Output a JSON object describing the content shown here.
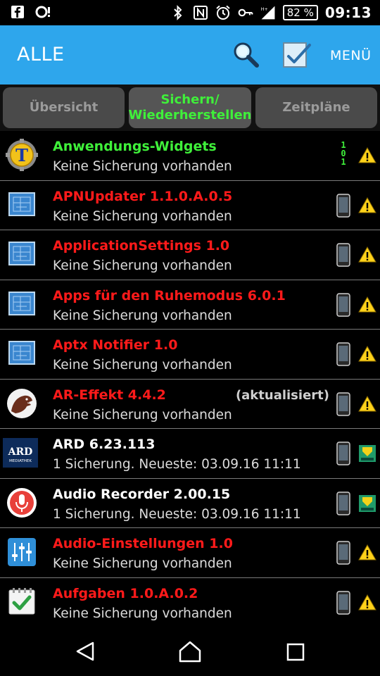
{
  "status_bar": {
    "time": "09:13",
    "battery": "82 %",
    "icons": [
      "facebook-icon",
      "notification-icon",
      "bluetooth-icon",
      "nfc-icon",
      "alarm-icon",
      "vpn-key-icon",
      "signal-icon"
    ]
  },
  "app_bar": {
    "title": "ALLE",
    "menu_label": "MENÜ",
    "color": "#2ea6ec"
  },
  "tabs": [
    {
      "label": "Übersicht",
      "active": false
    },
    {
      "label_line1": "Sichern/",
      "label_line2": "Wiederherstellen",
      "active": true
    },
    {
      "label": "Zeitpläne",
      "active": false
    }
  ],
  "apps": [
    {
      "name": "Anwendungs-Widgets",
      "sub": "Keine Sicherung vorhanden",
      "color": "green",
      "icon": "titanium-widget-icon",
      "device": "binary",
      "status": "warning"
    },
    {
      "name": "APNUpdater 1.1.0.A.0.5",
      "sub": "Keine Sicherung vorhanden",
      "color": "red",
      "icon": "blueprint-app-icon",
      "device": "phone",
      "status": "warning"
    },
    {
      "name": "ApplicationSettings 1.0",
      "sub": "Keine Sicherung vorhanden",
      "color": "red",
      "icon": "blueprint-app-icon",
      "device": "phone",
      "status": "warning"
    },
    {
      "name": "Apps für den Ruhemodus 6.0.1",
      "sub": "Keine Sicherung vorhanden",
      "color": "red",
      "icon": "blueprint-app-icon",
      "device": "phone",
      "status": "warning"
    },
    {
      "name": "Aptx Notifier 1.0",
      "sub": "Keine Sicherung vorhanden",
      "color": "red",
      "icon": "blueprint-app-icon",
      "device": "phone",
      "status": "warning"
    },
    {
      "name": "AR-Effekt 4.4.2",
      "sub": "Keine Sicherung vorhanden",
      "color": "red",
      "icon": "dinosaur-icon",
      "device": "phone",
      "status": "warning",
      "extra": "(aktualisiert)"
    },
    {
      "name": "ARD 6.23.113",
      "sub": "1 Sicherung. Neueste: 03.09.16 11:11",
      "color": "white",
      "icon": "ard-logo-icon",
      "device": "phone",
      "status": "backup"
    },
    {
      "name": "Audio Recorder 2.00.15",
      "sub": "1 Sicherung. Neueste: 03.09.16 11:11",
      "color": "white",
      "icon": "microphone-icon",
      "device": "phone",
      "status": "backup"
    },
    {
      "name": "Audio-Einstellungen 1.0",
      "sub": "Keine Sicherung vorhanden",
      "color": "red",
      "icon": "equalizer-icon",
      "device": "phone",
      "status": "warning"
    },
    {
      "name": "Aufgaben 1.0.A.0.2",
      "sub": "Keine Sicherung vorhanden",
      "color": "red",
      "icon": "tasks-checkmark-icon",
      "device": "phone",
      "status": "warning"
    }
  ],
  "ard_logo_text": "ARD",
  "ard_logo_subtext": "MEDIATHEK",
  "binary_digits": [
    "1",
    "0",
    "1"
  ]
}
